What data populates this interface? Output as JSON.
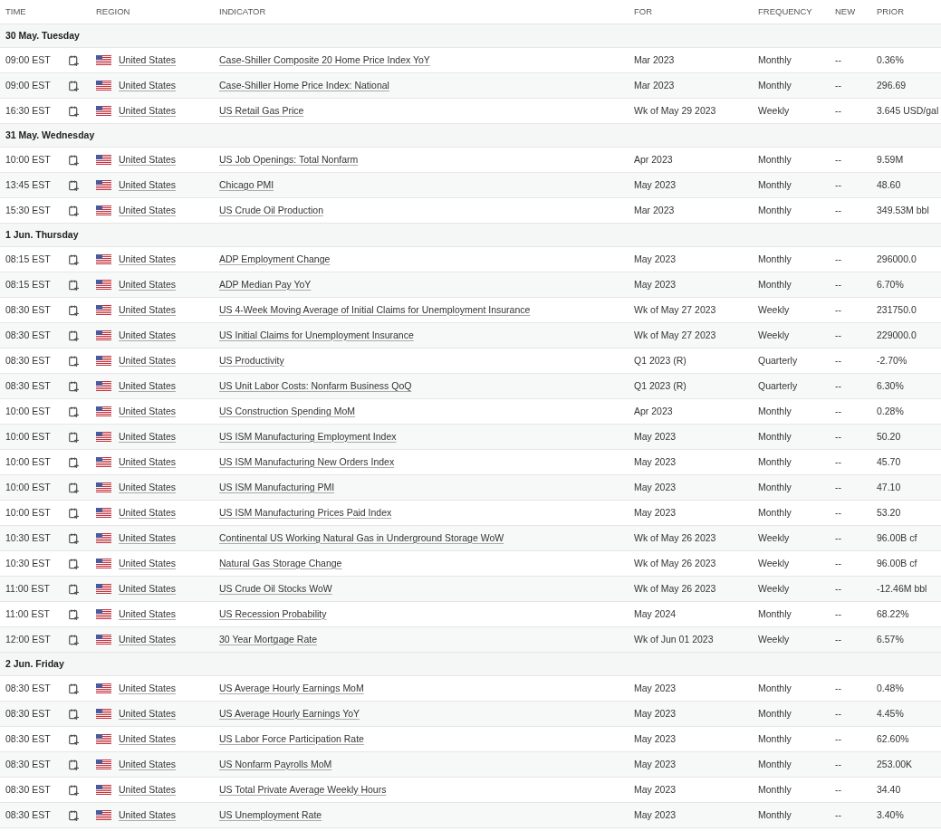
{
  "columns": [
    "TIME",
    "REGION",
    "INDICATOR",
    "FOR",
    "FREQUENCY",
    "NEW",
    "PRIOR"
  ],
  "groups": [
    {
      "date": "30 May. Tuesday",
      "rows": [
        {
          "time": "09:00 EST",
          "region": "United States",
          "indicator": "Case-Shiller Composite 20 Home Price Index YoY",
          "for": "Mar 2023",
          "frequency": "Monthly",
          "new": "--",
          "prior": "0.36%"
        },
        {
          "time": "09:00 EST",
          "region": "United States",
          "indicator": "Case-Shiller Home Price Index: National",
          "for": "Mar 2023",
          "frequency": "Monthly",
          "new": "--",
          "prior": "296.69"
        },
        {
          "time": "16:30 EST",
          "region": "United States",
          "indicator": "US Retail Gas Price",
          "for": "Wk of May 29 2023",
          "frequency": "Weekly",
          "new": "--",
          "prior": "3.645 USD/gal"
        }
      ]
    },
    {
      "date": "31 May. Wednesday",
      "rows": [
        {
          "time": "10:00 EST",
          "region": "United States",
          "indicator": "US Job Openings: Total Nonfarm",
          "for": "Apr 2023",
          "frequency": "Monthly",
          "new": "--",
          "prior": "9.59M"
        },
        {
          "time": "13:45 EST",
          "region": "United States",
          "indicator": "Chicago PMI",
          "for": "May 2023",
          "frequency": "Monthly",
          "new": "--",
          "prior": "48.60"
        },
        {
          "time": "15:30 EST",
          "region": "United States",
          "indicator": "US Crude Oil Production",
          "for": "Mar 2023",
          "frequency": "Monthly",
          "new": "--",
          "prior": "349.53M bbl"
        }
      ]
    },
    {
      "date": "1 Jun. Thursday",
      "rows": [
        {
          "time": "08:15 EST",
          "region": "United States",
          "indicator": "ADP Employment Change",
          "for": "May 2023",
          "frequency": "Monthly",
          "new": "--",
          "prior": "296000.0"
        },
        {
          "time": "08:15 EST",
          "region": "United States",
          "indicator": "ADP Median Pay YoY",
          "for": "May 2023",
          "frequency": "Monthly",
          "new": "--",
          "prior": "6.70%"
        },
        {
          "time": "08:30 EST",
          "region": "United States",
          "indicator": "US 4-Week Moving Average of Initial Claims for Unemployment Insurance",
          "for": "Wk of May 27 2023",
          "frequency": "Weekly",
          "new": "--",
          "prior": "231750.0"
        },
        {
          "time": "08:30 EST",
          "region": "United States",
          "indicator": "US Initial Claims for Unemployment Insurance",
          "for": "Wk of May 27 2023",
          "frequency": "Weekly",
          "new": "--",
          "prior": "229000.0"
        },
        {
          "time": "08:30 EST",
          "region": "United States",
          "indicator": "US Productivity",
          "for": "Q1 2023 (R)",
          "frequency": "Quarterly",
          "new": "--",
          "prior": "-2.70%"
        },
        {
          "time": "08:30 EST",
          "region": "United States",
          "indicator": "US Unit Labor Costs: Nonfarm Business QoQ",
          "for": "Q1 2023 (R)",
          "frequency": "Quarterly",
          "new": "--",
          "prior": "6.30%"
        },
        {
          "time": "10:00 EST",
          "region": "United States",
          "indicator": "US Construction Spending MoM",
          "for": "Apr 2023",
          "frequency": "Monthly",
          "new": "--",
          "prior": "0.28%"
        },
        {
          "time": "10:00 EST",
          "region": "United States",
          "indicator": "US ISM Manufacturing Employment Index",
          "for": "May 2023",
          "frequency": "Monthly",
          "new": "--",
          "prior": "50.20"
        },
        {
          "time": "10:00 EST",
          "region": "United States",
          "indicator": "US ISM Manufacturing New Orders Index",
          "for": "May 2023",
          "frequency": "Monthly",
          "new": "--",
          "prior": "45.70"
        },
        {
          "time": "10:00 EST",
          "region": "United States",
          "indicator": "US ISM Manufacturing PMI",
          "for": "May 2023",
          "frequency": "Monthly",
          "new": "--",
          "prior": "47.10"
        },
        {
          "time": "10:00 EST",
          "region": "United States",
          "indicator": "US ISM Manufacturing Prices Paid Index",
          "for": "May 2023",
          "frequency": "Monthly",
          "new": "--",
          "prior": "53.20"
        },
        {
          "time": "10:30 EST",
          "region": "United States",
          "indicator": "Continental US Working Natural Gas in Underground Storage WoW",
          "for": "Wk of May 26 2023",
          "frequency": "Weekly",
          "new": "--",
          "prior": "96.00B cf"
        },
        {
          "time": "10:30 EST",
          "region": "United States",
          "indicator": "Natural Gas Storage Change",
          "for": "Wk of May 26 2023",
          "frequency": "Weekly",
          "new": "--",
          "prior": "96.00B cf"
        },
        {
          "time": "11:00 EST",
          "region": "United States",
          "indicator": "US Crude Oil Stocks WoW",
          "for": "Wk of May 26 2023",
          "frequency": "Weekly",
          "new": "--",
          "prior": "-12.46M bbl"
        },
        {
          "time": "11:00 EST",
          "region": "United States",
          "indicator": "US Recession Probability",
          "for": "May 2024",
          "frequency": "Monthly",
          "new": "--",
          "prior": "68.22%"
        },
        {
          "time": "12:00 EST",
          "region": "United States",
          "indicator": "30 Year Mortgage Rate",
          "for": "Wk of Jun 01 2023",
          "frequency": "Weekly",
          "new": "--",
          "prior": "6.57%"
        }
      ]
    },
    {
      "date": "2 Jun. Friday",
      "rows": [
        {
          "time": "08:30 EST",
          "region": "United States",
          "indicator": "US Average Hourly Earnings MoM",
          "for": "May 2023",
          "frequency": "Monthly",
          "new": "--",
          "prior": "0.48%"
        },
        {
          "time": "08:30 EST",
          "region": "United States",
          "indicator": "US Average Hourly Earnings YoY",
          "for": "May 2023",
          "frequency": "Monthly",
          "new": "--",
          "prior": "4.45%"
        },
        {
          "time": "08:30 EST",
          "region": "United States",
          "indicator": "US Labor Force Participation Rate",
          "for": "May 2023",
          "frequency": "Monthly",
          "new": "--",
          "prior": "62.60%"
        },
        {
          "time": "08:30 EST",
          "region": "United States",
          "indicator": "US Nonfarm Payrolls MoM",
          "for": "May 2023",
          "frequency": "Monthly",
          "new": "--",
          "prior": "253.00K"
        },
        {
          "time": "08:30 EST",
          "region": "United States",
          "indicator": "US Total Private Average Weekly Hours",
          "for": "May 2023",
          "frequency": "Monthly",
          "new": "--",
          "prior": "34.40"
        },
        {
          "time": "08:30 EST",
          "region": "United States",
          "indicator": "US Unemployment Rate",
          "for": "May 2023",
          "frequency": "Monthly",
          "new": "--",
          "prior": "3.40%"
        }
      ]
    }
  ]
}
